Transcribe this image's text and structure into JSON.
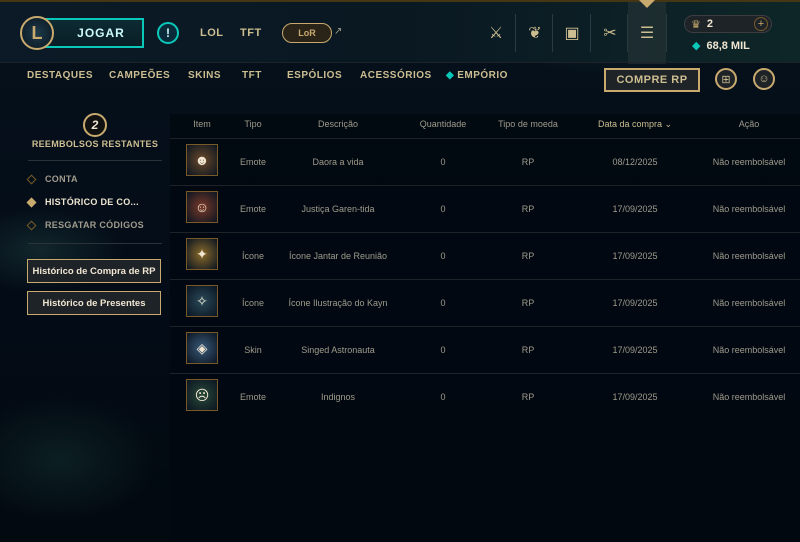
{
  "header": {
    "logo_letter": "L",
    "play_label": "JOGAR",
    "alert_glyph": "!",
    "games": [
      "LOL",
      "TFT"
    ],
    "lor_label": "LoR",
    "currency": {
      "rp": "2",
      "be": "68,8 MIL"
    }
  },
  "store_nav": {
    "tabs": [
      "DESTAQUES",
      "CAMPEÕES",
      "SKINS",
      "TFT",
      "ESPÓLIOS",
      "ACESSÓRIOS",
      "EMPÓRIO"
    ],
    "buy_rp_label": "COMPRE RP"
  },
  "sidebar": {
    "refund_count": "2",
    "refund_label": "REEMBOLSOS RESTANTES",
    "items": [
      {
        "label": "CONTA",
        "active": false
      },
      {
        "label": "HISTÓRICO DE CO...",
        "active": true
      },
      {
        "label": "RESGATAR CÓDIGOS",
        "active": false
      }
    ],
    "buttons": [
      "Histórico de Compra de RP",
      "Histórico de Presentes"
    ]
  },
  "table": {
    "headers": [
      "Item",
      "Tipo",
      "Descrição",
      "Quantidade",
      "Tipo de moeda",
      "Data da compra",
      "Ação"
    ],
    "rows": [
      {
        "type": "Emote",
        "description": "Daora a vida",
        "quantity": "0",
        "currency": "RP",
        "date": "08/12/2025",
        "action": "Não reembolsável",
        "thumb_color": "#6b4a2a",
        "thumb_glyph": "☻"
      },
      {
        "type": "Emote",
        "description": "Justiça Garen-tida",
        "quantity": "0",
        "currency": "RP",
        "date": "17/09/2025",
        "action": "Não reembolsável",
        "thumb_color": "#7a3a2a",
        "thumb_glyph": "☺"
      },
      {
        "type": "Ícone",
        "description": "Ícone Jantar de Reunião",
        "quantity": "0",
        "currency": "RP",
        "date": "17/09/2025",
        "action": "Não reembolsável",
        "thumb_color": "#8a6a2a",
        "thumb_glyph": "✦"
      },
      {
        "type": "Ícone",
        "description": "Ícone Ilustração do Kayn",
        "quantity": "0",
        "currency": "RP",
        "date": "17/09/2025",
        "action": "Não reembolsável",
        "thumb_color": "#2a4a5a",
        "thumb_glyph": "✧"
      },
      {
        "type": "Skin",
        "description": "Singed Astronauta",
        "quantity": "0",
        "currency": "RP",
        "date": "17/09/2025",
        "action": "Não reembolsável",
        "thumb_color": "#3a5a7a",
        "thumb_glyph": "◈"
      },
      {
        "type": "Emote",
        "description": "Indignos",
        "quantity": "0",
        "currency": "RP",
        "date": "17/09/2025",
        "action": "Não reembolsável",
        "thumb_color": "#2a4a3a",
        "thumb_glyph": "☹"
      }
    ]
  },
  "colors": {
    "gold": "#c8aa6e",
    "teal": "#0ac8b9",
    "bg": "#010a13"
  },
  "icons": [
    "clash-icon",
    "tft-icon",
    "collection-icon",
    "loot-icon",
    "store-icon",
    "rp-icon",
    "blue-essence-icon",
    "gift-icon",
    "add-friend-icon"
  ]
}
